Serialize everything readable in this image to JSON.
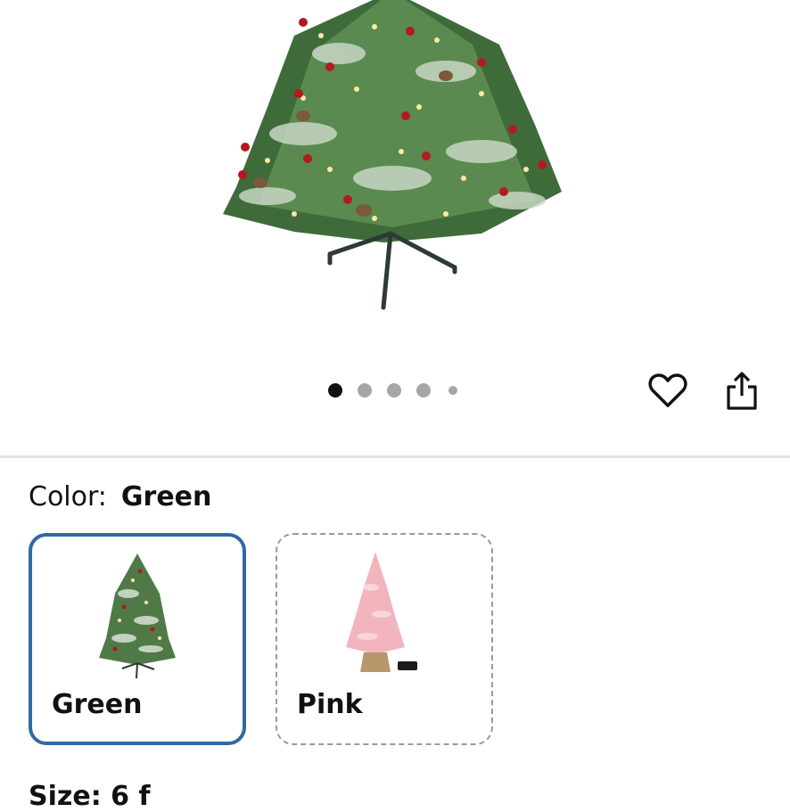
{
  "product": {
    "image_alt": "Pre-lit flocked Christmas tree with red berries and pine cones",
    "carousel": {
      "count": 5,
      "active_index": 0
    }
  },
  "actions": {
    "favorite": "heart-icon",
    "share": "share-icon"
  },
  "color_selector": {
    "label": "Color:",
    "selected": "Green",
    "options": [
      {
        "name": "Green",
        "selected": true
      },
      {
        "name": "Pink",
        "selected": false
      }
    ]
  },
  "next_section_cutoff": "Size: 6 f"
}
